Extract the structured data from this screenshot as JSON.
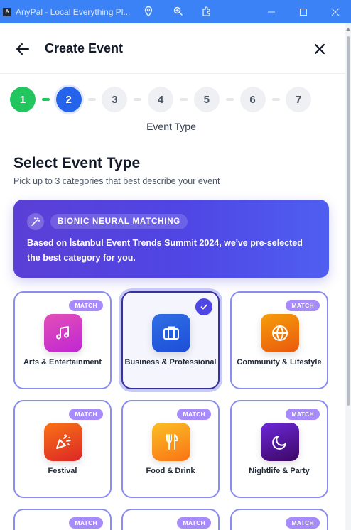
{
  "window": {
    "app_icon_letter": "A",
    "title": "AnyPal - Local Everything Pl..."
  },
  "header": {
    "title": "Create Event"
  },
  "stepper": {
    "steps": [
      "1",
      "2",
      "3",
      "4",
      "5",
      "6",
      "7"
    ],
    "current_step": 2,
    "current_label": "Event Type"
  },
  "section": {
    "title": "Select Event Type",
    "subtitle": "Pick up to 3 categories that best describe your event"
  },
  "banner": {
    "badge": "BIONIC NEURAL MATCHING",
    "text_prefix": "Based on ",
    "text_event": "İstanbul Event Trends Summit 2024",
    "text_suffix": ", we've pre-selected the best category for you."
  },
  "match_label": "MATCH",
  "categories": [
    {
      "label": "Arts & Entertainment",
      "icon": "music-note-icon",
      "color_from": "#e24fb7",
      "color_to": "#c026d3",
      "match": true,
      "selected": false
    },
    {
      "label": "Business & Professional",
      "icon": "briefcase-icon",
      "color_from": "#2f6fe4",
      "color_to": "#1d4ed8",
      "match": false,
      "selected": true
    },
    {
      "label": "Community & Lifestyle",
      "icon": "globe-icon",
      "color_from": "#f59e0b",
      "color_to": "#ea580c",
      "match": true,
      "selected": false
    },
    {
      "label": "Festival",
      "icon": "party-popper-icon",
      "color_from": "#f97316",
      "color_to": "#dc2626",
      "match": true,
      "selected": false
    },
    {
      "label": "Food & Drink",
      "icon": "utensils-icon",
      "color_from": "#fbbf24",
      "color_to": "#f97316",
      "match": true,
      "selected": false
    },
    {
      "label": "Nightlife & Party",
      "icon": "moon-icon",
      "color_from": "#6d28d9",
      "color_to": "#3b0764",
      "match": true,
      "selected": false
    }
  ]
}
